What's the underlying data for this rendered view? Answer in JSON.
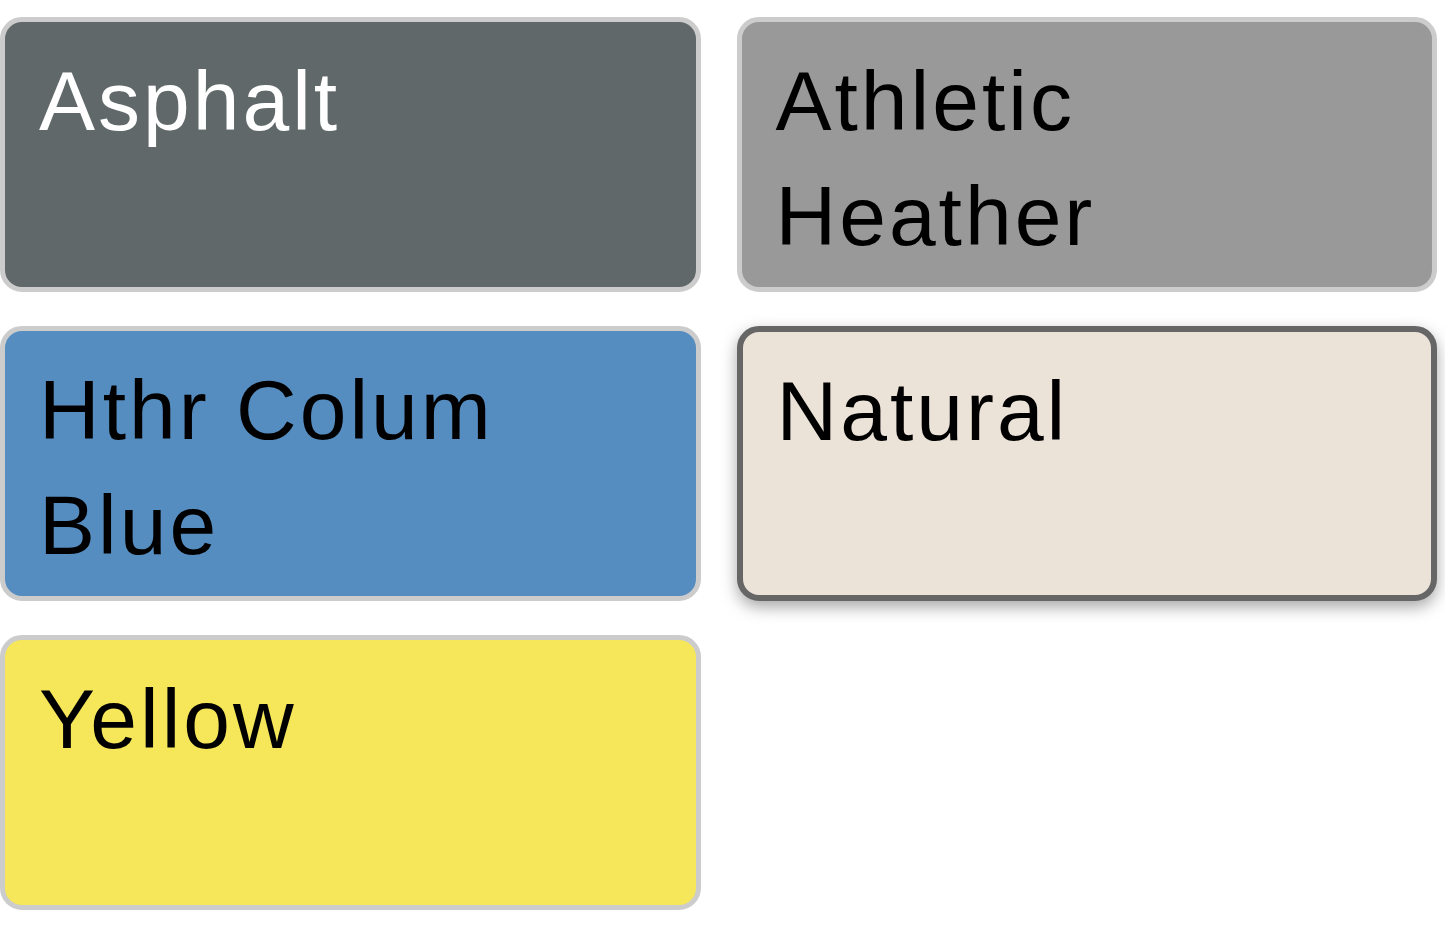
{
  "swatches": [
    {
      "label": "Asphalt",
      "color": "#61686a",
      "selected": false
    },
    {
      "label": "Athletic Heather",
      "color": "#999999",
      "selected": false
    },
    {
      "label": "Hthr Colum Blue",
      "color": "#568dc0",
      "selected": false
    },
    {
      "label": "Natural",
      "color": "#ebe2d8",
      "selected": true
    },
    {
      "label": "Yellow",
      "color": "#f6e659",
      "selected": false
    }
  ]
}
